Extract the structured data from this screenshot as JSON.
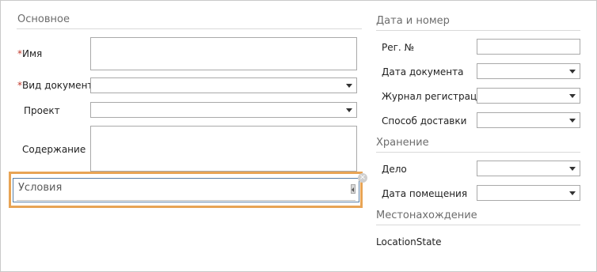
{
  "sections": {
    "main": "Основное",
    "date_number": "Дата и номер",
    "storage": "Хранение",
    "location": "Местонахождение"
  },
  "left_fields": {
    "name_label": "Имя",
    "doc_type_label": "Вид документа",
    "project_label": "Проект",
    "content_label": "Содержание",
    "required_mark": "*"
  },
  "conditions": {
    "value": "Условия"
  },
  "right_fields": {
    "reg_no_label": "Рег. №",
    "doc_date_label": "Дата документа",
    "journal_label": "Журнал регистрации",
    "delivery_label": "Способ доставки",
    "case_label": "Дело",
    "placement_date_label": "Дата помещения",
    "location_state": "LocationState"
  },
  "icons": {
    "close": "close-icon",
    "dropdown": "chevron-down-icon"
  }
}
